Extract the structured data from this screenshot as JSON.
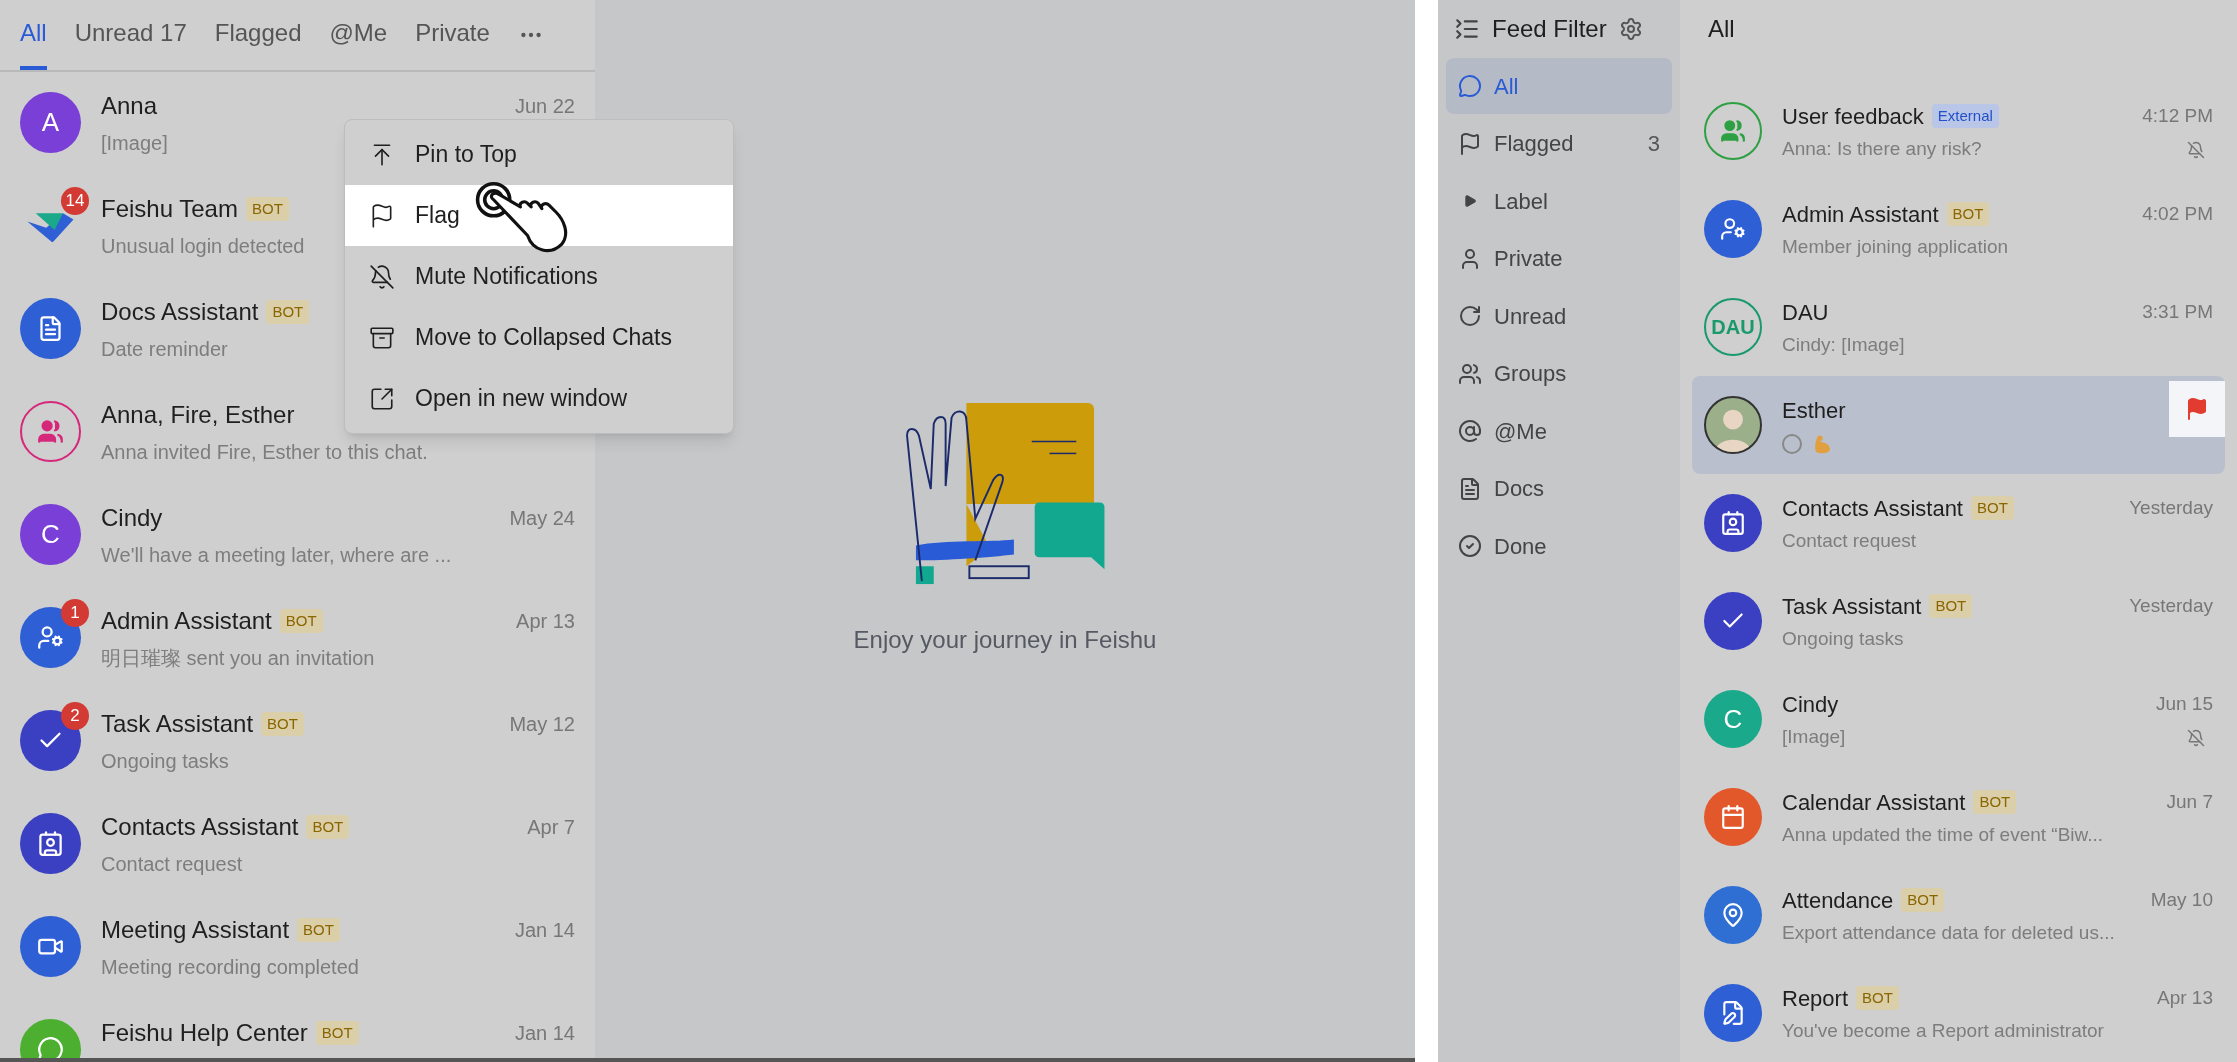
{
  "left": {
    "tabs": [
      {
        "label": "All",
        "selected": true
      },
      {
        "label": "Unread 17",
        "selected": false
      },
      {
        "label": "Flagged",
        "selected": false
      },
      {
        "label": "@Me",
        "selected": false
      },
      {
        "label": "Private",
        "selected": false
      }
    ],
    "chats": [
      {
        "name": "Anna",
        "preview": "[Image]",
        "time": "Jun 22",
        "avatar": {
          "kind": "letter",
          "letter": "A",
          "color": "#7a3fd6"
        }
      },
      {
        "name": "Feishu Team",
        "tag": {
          "kind": "bot",
          "text": "BOT"
        },
        "preview": "Unusual login detected",
        "unread": "14",
        "avatar": {
          "kind": "feishu"
        }
      },
      {
        "name": "Docs Assistant",
        "tag": {
          "kind": "bot",
          "text": "BOT"
        },
        "preview": "Date reminder",
        "avatar": {
          "kind": "docs"
        }
      },
      {
        "name": "Anna, Fire, Esther",
        "preview": "Anna invited Fire, Esther to this chat.",
        "avatar": {
          "kind": "group"
        }
      },
      {
        "name": "Cindy",
        "preview": "We'll have a meeting later, where are ...",
        "time": "May 24",
        "avatar": {
          "kind": "letter",
          "letter": "C",
          "color": "#7a3fd6"
        }
      },
      {
        "name": "Admin Assistant",
        "tag": {
          "kind": "bot",
          "text": "BOT"
        },
        "preview": "明日璀璨 sent you an invitation",
        "time": "Apr 13",
        "unread": "1",
        "avatar": {
          "kind": "admin"
        }
      },
      {
        "name": "Task Assistant",
        "tag": {
          "kind": "bot",
          "text": "BOT"
        },
        "preview": "Ongoing tasks",
        "time": "May 12",
        "unread": "2",
        "avatar": {
          "kind": "task"
        }
      },
      {
        "name": "Contacts Assistant",
        "tag": {
          "kind": "bot",
          "text": "BOT"
        },
        "preview": "Contact request",
        "time": "Apr 7",
        "avatar": {
          "kind": "contacts"
        }
      },
      {
        "name": "Meeting Assistant",
        "tag": {
          "kind": "bot",
          "text": "BOT"
        },
        "preview": "Meeting recording completed",
        "time": "Jan 14",
        "avatar": {
          "kind": "meeting"
        }
      },
      {
        "name": "Feishu Help Center",
        "tag": {
          "kind": "bot",
          "text": "BOT"
        },
        "time": "Jan 14",
        "avatar": {
          "kind": "help"
        }
      }
    ],
    "menu": [
      {
        "kind": "pin",
        "label": "Pin to Top",
        "selected": false
      },
      {
        "kind": "flag",
        "label": "Flag",
        "selected": true
      },
      {
        "kind": "mute",
        "label": "Mute Notifications",
        "selected": false
      },
      {
        "kind": "archive",
        "label": "Move to Collapsed Chats",
        "selected": false
      },
      {
        "kind": "window",
        "label": "Open in new window",
        "selected": false
      }
    ]
  },
  "center": {
    "message": "Enjoy your journey in Feishu"
  },
  "right": {
    "sidebar": {
      "title": "Feed Filter",
      "items": [
        {
          "kind": "all",
          "label": "All",
          "selected": true
        },
        {
          "kind": "flag",
          "label": "Flagged",
          "count": "3",
          "selected": false
        },
        {
          "kind": "caret",
          "label": "Label",
          "selected": false
        },
        {
          "kind": "person",
          "label": "Private",
          "selected": false
        },
        {
          "kind": "unread",
          "label": "Unread",
          "selected": false
        },
        {
          "kind": "groups",
          "label": "Groups",
          "selected": false
        },
        {
          "kind": "at",
          "label": "@Me",
          "selected": false
        },
        {
          "kind": "docs",
          "label": "Docs",
          "selected": false
        },
        {
          "kind": "done",
          "label": "Done",
          "selected": false
        }
      ]
    },
    "list_title": "All",
    "chats": [
      {
        "kind": "message",
        "name": "User feedback",
        "tag": {
          "kind": "external",
          "text": "External"
        },
        "preview": "Anna: Is there any risk?",
        "time": "4:12 PM",
        "muted": true,
        "selected": false,
        "flagged": false,
        "avatar": {
          "kind": "group-green"
        }
      },
      {
        "kind": "message",
        "name": "Admin Assistant",
        "tag": {
          "kind": "bot",
          "text": "BOT"
        },
        "preview": "Member joining application",
        "time": "4:02 PM",
        "muted": false,
        "selected": false,
        "flagged": false,
        "avatar": {
          "kind": "admin"
        }
      },
      {
        "kind": "message",
        "name": "DAU",
        "preview": "Cindy: [Image]",
        "time": "3:31 PM",
        "muted": false,
        "selected": false,
        "flagged": false,
        "avatar": {
          "kind": "text-outline",
          "letter": "DAU"
        }
      },
      {
        "kind": "status",
        "name": "Esther",
        "muted": false,
        "selected": true,
        "flagged": true,
        "avatar": {
          "kind": "person"
        }
      },
      {
        "kind": "message",
        "name": "Contacts Assistant",
        "tag": {
          "kind": "bot",
          "text": "BOT"
        },
        "preview": "Contact request",
        "time": "Yesterday",
        "muted": false,
        "selected": false,
        "flagged": false,
        "avatar": {
          "kind": "contacts"
        }
      },
      {
        "kind": "message",
        "name": "Task Assistant",
        "tag": {
          "kind": "bot",
          "text": "BOT"
        },
        "preview": "Ongoing tasks",
        "time": "Yesterday",
        "muted": false,
        "selected": false,
        "flagged": false,
        "avatar": {
          "kind": "task"
        }
      },
      {
        "kind": "message",
        "name": "Cindy",
        "preview": "[Image]",
        "time": "Jun 15",
        "muted": true,
        "selected": false,
        "flagged": false,
        "avatar": {
          "kind": "letter",
          "letter": "C",
          "color": "#1aa98a"
        }
      },
      {
        "kind": "message",
        "name": "Calendar Assistant",
        "tag": {
          "kind": "bot",
          "text": "BOT"
        },
        "preview": "Anna updated the time of event “Biw...",
        "time": "Jun 7",
        "muted": false,
        "selected": false,
        "flagged": false,
        "avatar": {
          "kind": "calendar"
        }
      },
      {
        "kind": "message",
        "name": "Attendance",
        "tag": {
          "kind": "bot",
          "text": "BOT"
        },
        "preview": "Export attendance data for deleted us...",
        "time": "May 10",
        "muted": false,
        "selected": false,
        "flagged": false,
        "avatar": {
          "kind": "attendance"
        }
      },
      {
        "kind": "message",
        "name": "Report",
        "tag": {
          "kind": "bot",
          "text": "BOT"
        },
        "preview": "You've become a Report administrator",
        "time": "Apr 13",
        "muted": false,
        "selected": false,
        "flagged": false,
        "avatar": {
          "kind": "report"
        }
      }
    ]
  }
}
